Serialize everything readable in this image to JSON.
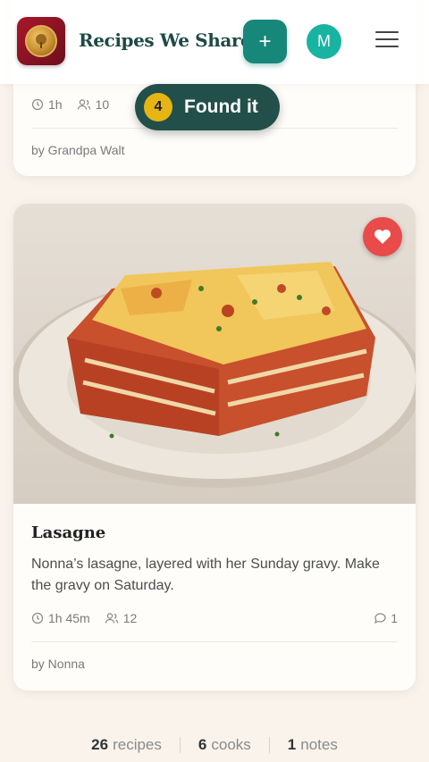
{
  "header": {
    "brand": "Recipes We Share",
    "add_label": "+",
    "avatar_initial": "M"
  },
  "toast": {
    "count": "4",
    "message": "Found it"
  },
  "recipes": [
    {
      "time": "1h",
      "serves": "10",
      "author": "by Grandpa Walt"
    },
    {
      "title": "Lasagne",
      "description": "Nonna’s lasagne, layered with her Sunday gravy. Make the gravy on Saturday.",
      "time": "1h 45m",
      "serves": "12",
      "comments": "1",
      "author": "by Nonna",
      "favorited": true
    }
  ],
  "stats": [
    {
      "num": "26",
      "label": "recipes"
    },
    {
      "num": "6",
      "label": "cooks"
    },
    {
      "num": "1",
      "label": "notes"
    }
  ],
  "colors": {
    "brand": "#1d4a45",
    "accent": "#17877a",
    "avatar": "#19b3a1",
    "favorite": "#e94a4a",
    "toast_bg": "#224f49",
    "toast_badge": "#e5b514"
  }
}
